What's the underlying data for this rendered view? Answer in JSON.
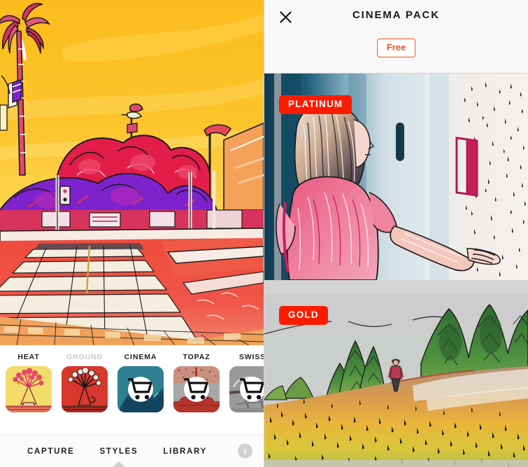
{
  "left": {
    "photo": {
      "name": "styled-street-photo",
      "description": "Stylized street scene with palm tree, crosswalk and sunset sky",
      "sky_top": "#fbbf24",
      "sky_bottom": "#fde68a",
      "foliage": "#e11d48",
      "accent_purple": "#7e22ce",
      "road": "#ef4444"
    },
    "styles": [
      {
        "label": "HEAT",
        "state": "owned",
        "locked": false,
        "bg": "#f2dc6b",
        "ink": "#d8345f"
      },
      {
        "label": "GROUND",
        "state": "downloading",
        "locked": false,
        "bg": "#d8372b",
        "ink": "#1a1a1a"
      },
      {
        "label": "CINEMA",
        "state": "locked",
        "locked": true,
        "bg": "#2e8092",
        "ink": "#123a52"
      },
      {
        "label": "TOPAZ",
        "state": "locked",
        "locked": true,
        "bg": "#a8a8a8",
        "ink": "#b5352a"
      },
      {
        "label": "SWISS",
        "state": "locked",
        "locked": true,
        "bg": "#9a9a9a",
        "ink": "#6b6b6b"
      }
    ],
    "cart_icon": "shopping-cart-icon",
    "nav": {
      "items": [
        {
          "label": "CAPTURE",
          "active": false
        },
        {
          "label": "STYLES",
          "active": true
        },
        {
          "label": "LIBRARY",
          "active": false
        }
      ],
      "info_label": "i",
      "info_icon": "info-icon"
    }
  },
  "right": {
    "close_icon": "close-icon",
    "title": "CINEMA PACK",
    "price_label": "Free",
    "price_color": "#f4511e",
    "previews": [
      {
        "tier": "PLATINUM",
        "badge_color": "#fb1c00",
        "name": "platinum-preview-image",
        "description": "Stylized photo of a woman in pink shirt touching a wall"
      },
      {
        "tier": "GOLD",
        "badge_color": "#fb1c00",
        "name": "gold-preview-image",
        "description": "Sketched landscape with pine trees, hiker and golden grass"
      }
    ]
  }
}
